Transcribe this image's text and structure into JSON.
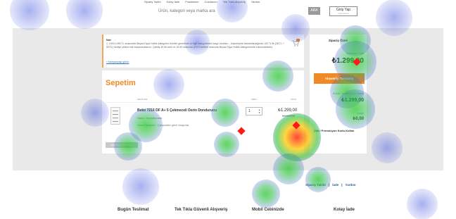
{
  "header": {
    "topnav": [
      "Sipariş Takibi",
      "Kolay İade",
      "Fırsatlarım",
      "Cüzdanım",
      "Tek Tıkla Alışveriş",
      "Yardım"
    ],
    "search_text": "Ürün, kategori veya marka ara",
    "search_button": "ARA",
    "login_label": "Giriş Yap",
    "login_sub": "veya üye ol"
  },
  "notice": {
    "title": "Not",
    "text": "1. 1000-1499 TL arasındaki Beyaz Eşya Hollük kategorisi ürünleri genelinde ve ilgili kategorilerde kargo ücretsiz... Alışverişiniz tamamlandığında 100 TL'lik (SETL + SETL) hediye çekine hak kazanacaksınız. Çekiliş 30.06 tarih ve 15:30 arasında (2019 tarihleri arasında Beyaz Eşya Hollük kategorisinde bulunmaktadır).",
    "more_link": "» Kampanyayı görün"
  },
  "cart": {
    "title": "Sepetim",
    "col_product": "ÜRÜN ADI",
    "col_qty": "ADET",
    "col_price": "FİYAT",
    "item": {
      "name": "Beko 7216 DF A+ 5 Çekmeceli Derin Dondurucu",
      "seller": "Satıcı: Hepsiburada",
      "shipping": "Yarın Kargoda · Çarşamba günü kargoda",
      "qty": "1",
      "price": "₺1.299,00",
      "old_price": "₺1.399,00"
    },
    "continue_button": "Alışverişe Devam Et"
  },
  "summary": {
    "title": "Sipariş Özeti",
    "total_label": "Ödenecek Tutar",
    "total": "₺1.299,00",
    "checkout_button": "Alışverişi Tamamla",
    "products_label": "Ürünler Toplamı (KDV Dahil)",
    "products_total": "₺1.299,00",
    "shipping_label": "Kargo",
    "shipping_value": "₺0,00",
    "promo_link": "Çek / Promosyon Kodu Kullan"
  },
  "footer": {
    "links": [
      "Sipariş Takibi",
      "İade",
      "Yardım"
    ],
    "features": [
      "Bugün Teslimat",
      "Tek Tıkla Güvenli Alışveriş",
      "Mobil Cebinizde",
      "Kolay İade"
    ]
  },
  "colors": {
    "accent": "#f08a24",
    "link": "#2a5fa5",
    "band": "#e9e9e9",
    "marker": "#ff1a1a"
  }
}
